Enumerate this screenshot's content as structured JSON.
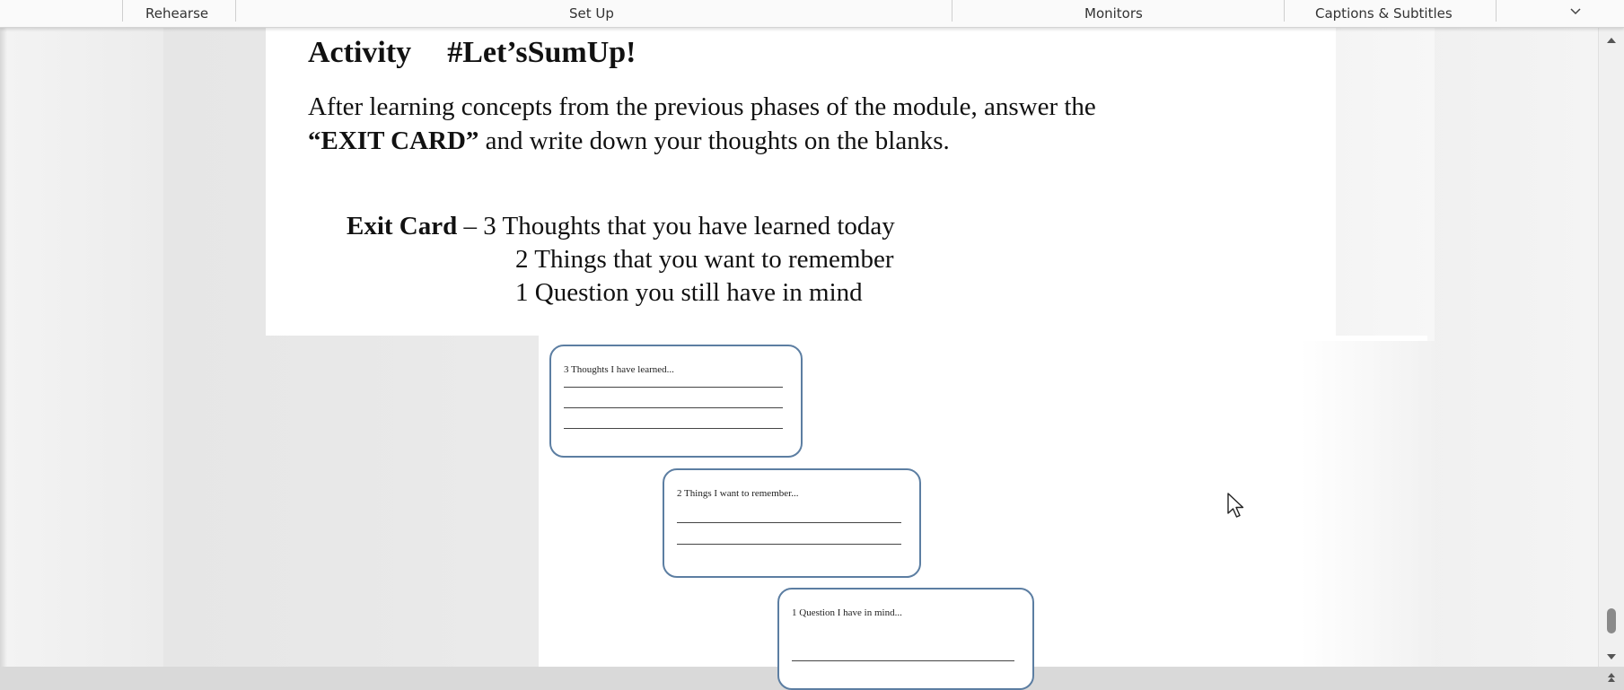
{
  "ribbon": {
    "groups": [
      "Rehearse",
      "Set Up",
      "Monitors",
      "Captions & Subtitles"
    ],
    "collapse_glyph": "⌄"
  },
  "document": {
    "title_left": "Activity",
    "title_right": "#Let’sSumUp!",
    "paragraph_line1": "After learning concepts from the previous phases of the module, answer the",
    "paragraph_bold": "“EXIT CARD”",
    "paragraph_line2_rest": " and write down your thoughts on the blanks.",
    "exit_bold": "Exit Card",
    "exit_line1_rest": " – 3 Thoughts that you have learned today",
    "exit_line2": "2 Things that you want to remember",
    "exit_line3": "1 Question you still have in mind"
  },
  "cards": [
    {
      "label": "3 Thoughts I have learned..."
    },
    {
      "label": "2 Things I want to remember..."
    },
    {
      "label": "1 Question I have in mind..."
    }
  ],
  "icons": {
    "collapse": "chevron-down-icon",
    "cursor": "mouse-pointer-icon",
    "scroll_up": "triangle-up-icon",
    "scroll_down": "triangle-down-icon",
    "previous_slide": "double-up-icon"
  },
  "colors": {
    "card_border": "#5c7ea2",
    "ribbon_bg": "#fafafa",
    "canvas_bg": "#e6e6e6"
  }
}
